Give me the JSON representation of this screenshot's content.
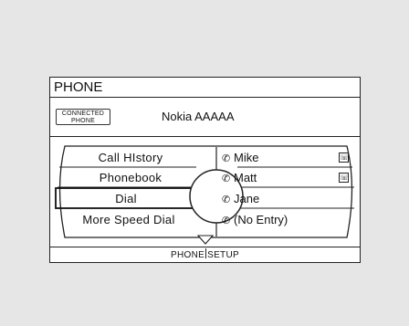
{
  "header": {
    "title": "PHONE"
  },
  "connection": {
    "badge_line1": "CONNECTED",
    "badge_line2": "PHONE",
    "device_name": "Nokia AAAAA"
  },
  "menu": {
    "items": [
      {
        "label": "Call HIstory",
        "selected": false
      },
      {
        "label": "Phonebook",
        "selected": false
      },
      {
        "label": "Dial",
        "selected": true
      },
      {
        "label": "More Speed Dial",
        "selected": false
      }
    ]
  },
  "speed_dial": {
    "entries": [
      {
        "slot_icon": "speed-dial-1-icon",
        "name": "Mike",
        "has_phone_icon": true
      },
      {
        "slot_icon": "speed-dial-2-icon",
        "name": "Matt",
        "has_phone_icon": true
      },
      {
        "slot_icon": "speed-dial-3-icon",
        "name": "Jane",
        "has_phone_icon": false
      },
      {
        "slot_icon": "speed-dial-4-icon",
        "name": "(No Entry)",
        "has_phone_icon": false
      }
    ]
  },
  "footer": {
    "left": "PHONE",
    "right": "SETUP"
  }
}
